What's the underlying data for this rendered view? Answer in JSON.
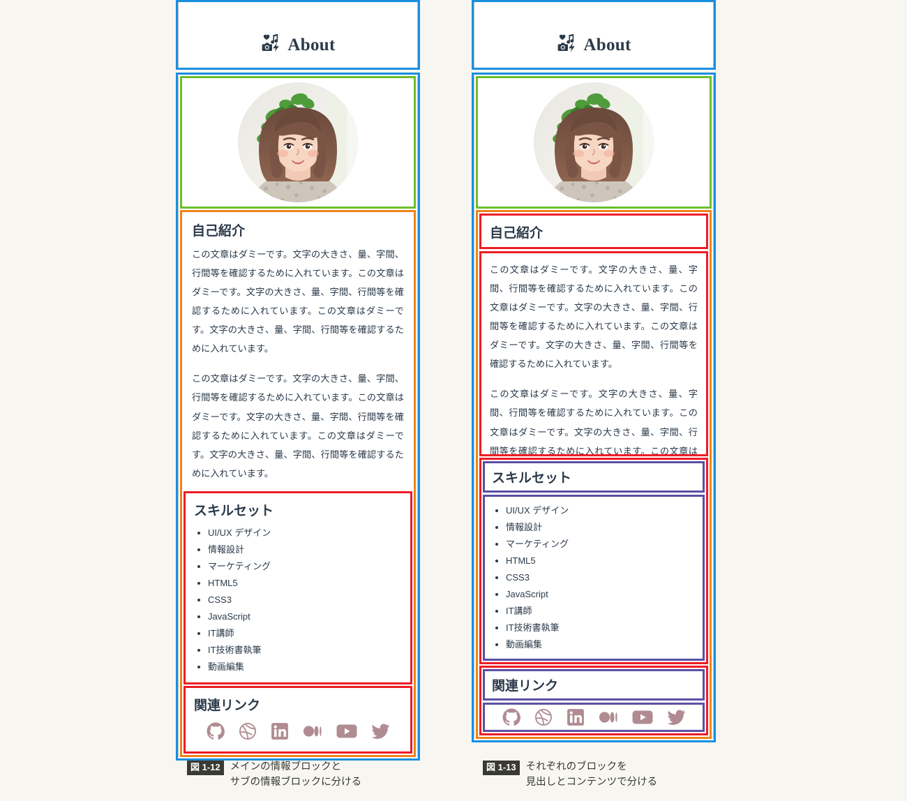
{
  "background_color": "#f7f6f1",
  "colors": {
    "blue": "#1a8fe0",
    "green": "#6cbe2a",
    "orange": "#f08219",
    "red": "#ee1c25",
    "purple": "#5a4fa3",
    "text": "#2b3a4a",
    "social": "#b08c92",
    "caption_badge": "#3a3a33"
  },
  "widget": {
    "header": {
      "title": "About",
      "icon": "about-media-grid-icon",
      "icon_parts": [
        "heart-icon",
        "music-note-icon",
        "camera-icon",
        "lightning-icon"
      ]
    },
    "photo": {
      "alt": "profile-photo",
      "shape": "circle"
    },
    "sections": [
      {
        "id": "intro",
        "title": "自己紹介",
        "paragraphs": [
          "この文章はダミーです。文字の大きさ、量、字間、行間等を確認するために入れています。この文章はダミーです。文字の大きさ、量、字間、行間等を確認するために入れています。この文章はダミーです。文字の大きさ、量、字間、行間等を確認するために入れています。",
          "この文章はダミーです。文字の大きさ、量、字間、行間等を確認するために入れています。この文章はダミーです。文字の大きさ、量、字間、行間等を確認するために入れています。この文章はダミーです。文字の大きさ、量、字間、行間等を確認するために入れています。"
        ]
      },
      {
        "id": "skills",
        "title": "スキルセット",
        "items": [
          "UI/UX デザイン",
          "情報設計",
          "マーケティング",
          "HTML5",
          "CSS3",
          "JavaScript",
          "IT講師",
          "IT技術書執筆",
          "動画編集"
        ]
      },
      {
        "id": "links",
        "title": "関連リンク",
        "social": [
          "github-icon",
          "dribbble-icon",
          "linkedin-icon",
          "medium-icon",
          "youtube-icon",
          "twitter-icon"
        ]
      }
    ]
  },
  "figures": [
    {
      "number": "図 1-12",
      "caption": "メインの情報ブロックと\nサブの情報ブロックに分ける"
    },
    {
      "number": "図 1-13",
      "caption": "それぞれのブロックを\n見出しとコンテンツで分ける"
    }
  ]
}
